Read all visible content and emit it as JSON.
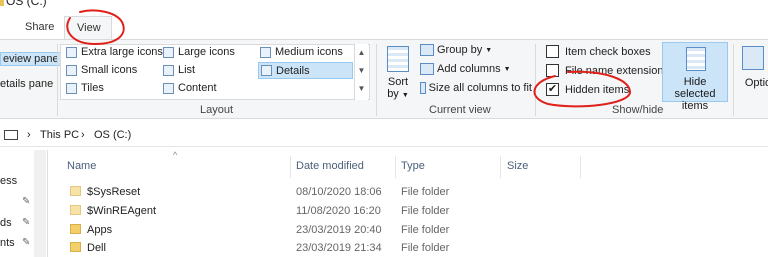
{
  "window": {
    "title": "OS (C:)"
  },
  "ribbon_tabs": [
    {
      "label": "Share"
    },
    {
      "label": "View",
      "active": true
    }
  ],
  "panes": {
    "preview_pane": "eview pane",
    "details_pane": "etails pane"
  },
  "layout_group": {
    "label": "Layout",
    "items": [
      {
        "label": "Extra large icons",
        "icon": "extra-large-icons-icon"
      },
      {
        "label": "Large icons",
        "icon": "large-icons-icon"
      },
      {
        "label": "Medium icons",
        "icon": "medium-icons-icon"
      },
      {
        "label": "Small icons",
        "icon": "small-icons-icon"
      },
      {
        "label": "List",
        "icon": "list-icon"
      },
      {
        "label": "Details",
        "icon": "details-icon",
        "selected": true
      },
      {
        "label": "Tiles",
        "icon": "tiles-icon"
      },
      {
        "label": "Content",
        "icon": "content-icon"
      }
    ]
  },
  "current_view_group": {
    "label": "Current view",
    "sort_by": "Sort",
    "sort_by_2": "by",
    "group_by": "Group by",
    "add_columns": "Add columns",
    "size_all_columns": "Size all columns to fit"
  },
  "show_hide_group": {
    "label": "Show/hide",
    "item_check_boxes": {
      "label": "Item check boxes",
      "checked": false
    },
    "file_name_extensions": {
      "label": "File name extensions",
      "checked": false
    },
    "hidden_items": {
      "label": "Hidden items",
      "checked": true
    },
    "hide_selected_1": "Hide selected",
    "hide_selected_2": "items",
    "options": "Optio"
  },
  "address": {
    "crumbs": [
      "This PC",
      "OS (C:)"
    ],
    "separator": "›"
  },
  "nav_pane": {
    "items": [
      "ess",
      "ds",
      "nts"
    ]
  },
  "columns": {
    "name": "Name",
    "date_modified": "Date modified",
    "type": "Type",
    "size": "Size"
  },
  "rows": [
    {
      "name": "$SysReset",
      "date": "08/10/2020 18:06",
      "type": "File folder",
      "hidden": true
    },
    {
      "name": "$WinREAgent",
      "date": "11/08/2020 16:20",
      "type": "File folder",
      "hidden": true
    },
    {
      "name": "Apps",
      "date": "23/03/2019 20:40",
      "type": "File folder",
      "hidden": false
    },
    {
      "name": "Dell",
      "date": "23/03/2019 21:34",
      "type": "File folder",
      "hidden": false
    }
  ],
  "colors": {
    "accent": "#cce4f7",
    "annotation": "#e0201b"
  }
}
